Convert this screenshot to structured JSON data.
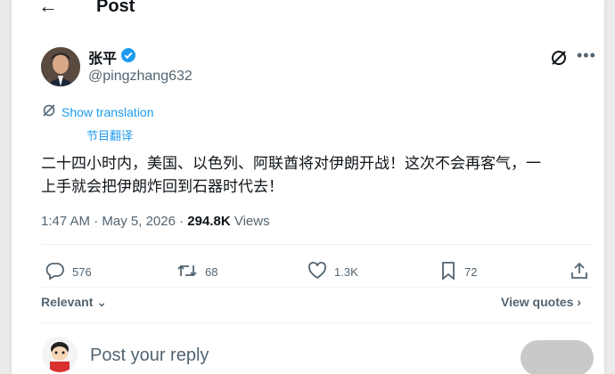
{
  "header": {
    "back_icon": "arrow-left-icon",
    "title": "Post"
  },
  "author": {
    "name": "张平",
    "handle": "@pingzhang632",
    "verified_color": "#1d9bf0"
  },
  "translate": {
    "label": "Show translation",
    "note": "节目翻译"
  },
  "tweet": {
    "text_line1": "二十四小时内，美国、以色列、阿联酋将对伊朗开战！这次不会再客气，一",
    "text_line2": "上手就会把伊朗炸回到石器时代去！"
  },
  "meta": {
    "time": "1:47 AM",
    "sep": " · ",
    "date": "May 5, 2026",
    "views_count": "294.8K",
    "views_label": "Views"
  },
  "actions": {
    "replies": "576",
    "reposts": "68",
    "likes": "1.3K",
    "bookmarks": "72"
  },
  "sort": {
    "label": "Relevant",
    "view_quotes": "View quotes"
  },
  "reply": {
    "placeholder": "Post your reply"
  },
  "colors": {
    "accent": "#1d9bf0",
    "muted": "#536471",
    "text": "#0f1419"
  }
}
